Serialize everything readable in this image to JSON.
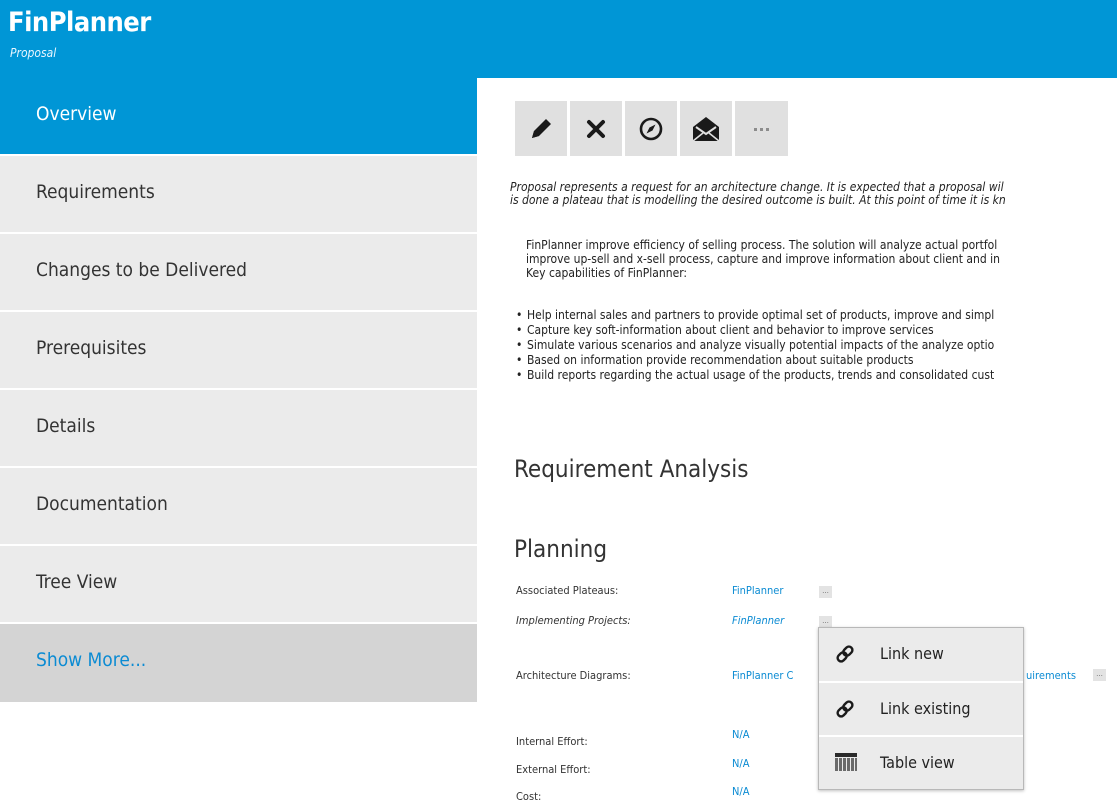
{
  "app": {
    "title": "FinPlanner",
    "subtitle": "Proposal"
  },
  "sidebar": {
    "items": [
      {
        "label": "Overview",
        "active": true
      },
      {
        "label": "Requirements"
      },
      {
        "label": "Changes to be Delivered"
      },
      {
        "label": "Prerequisites"
      },
      {
        "label": "Details"
      },
      {
        "label": "Documentation"
      },
      {
        "label": "Tree View"
      }
    ],
    "show_more": "Show More..."
  },
  "toolbar": {
    "buttons": [
      {
        "icon": "pencil-icon"
      },
      {
        "icon": "close-icon"
      },
      {
        "icon": "compass-icon"
      },
      {
        "icon": "envelope-icon"
      },
      {
        "icon": "more-icon"
      }
    ]
  },
  "intro": {
    "line1": "Proposal represents a request for an architecture change. It is expected that a proposal wil",
    "line2": "is done a plateau that is modelling the desired outcome is built. At this point of time it is kn"
  },
  "description": {
    "line1": "FinPlanner improve efficiency of selling process. The solution will analyze actual portfol",
    "line2": "improve up-sell and x-sell process, capture and improve information about client and in",
    "line3": "Key capabilities of FinPlanner:"
  },
  "bullets": [
    "Help internal sales and partners to provide optimal set of products, improve and simpl",
    "Capture key soft-information about client and behavior to improve services",
    "Simulate various scenarios and analyze visually potential impacts of the analyze optio",
    "Based on information provide recommendation about suitable products",
    "Build reports regarding the actual usage of the products, trends and consolidated cust"
  ],
  "sections": {
    "requirement_analysis": "Requirement Analysis",
    "planning": "Planning"
  },
  "fields": {
    "associated_plateaus": {
      "label": "Associated Plateaus:",
      "value": "FinPlanner"
    },
    "implementing_projects": {
      "label": "Implementing Projects:",
      "value": "FinPlanner"
    },
    "architecture_diagrams": {
      "label": "Architecture Diagrams:",
      "value_left": "FinPlanner C",
      "value_right": "uirements"
    },
    "internal_effort": {
      "label": "Internal Effort:",
      "value": "N/A"
    },
    "external_effort": {
      "label": "External Effort:",
      "value": "N/A"
    },
    "cost": {
      "label": "Cost:",
      "value": "N/A"
    }
  },
  "dots_label": "...",
  "context_menu": {
    "items": [
      {
        "label": "Link new",
        "icon": "link-icon"
      },
      {
        "label": "Link existing",
        "icon": "link-icon"
      },
      {
        "label": "Table view",
        "icon": "table-icon"
      }
    ]
  },
  "colors": {
    "accent": "#0096d6",
    "link": "#0b8bd3",
    "sidebar_bg": "#ebebeb",
    "show_more_bg": "#d4d4d4"
  }
}
